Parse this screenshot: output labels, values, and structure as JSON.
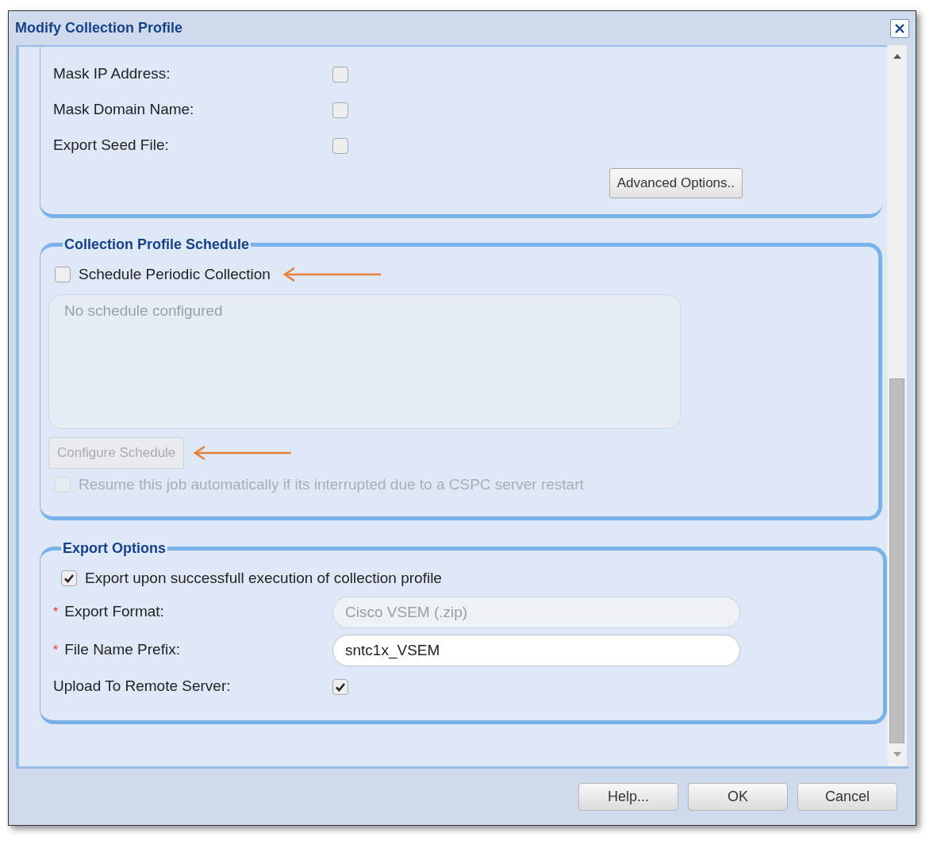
{
  "window": {
    "title": "Modify Collection Profile"
  },
  "options": {
    "rows": [
      {
        "label": "Mask IP Address:",
        "checked": false
      },
      {
        "label": "Mask Domain Name:",
        "checked": false
      },
      {
        "label": "Export Seed File:",
        "checked": false
      }
    ],
    "button": {
      "label": "Advanced Options.."
    }
  },
  "schedule": {
    "legend": "Collection Profile Schedule",
    "periodic": {
      "label": "Schedule Periodic Collection",
      "checked": false
    },
    "schedule_box": {
      "placeholder": "No schedule configured",
      "disabled": true
    },
    "configure_button": {
      "label": "Configure Schedule",
      "disabled": true
    },
    "resume": {
      "label": "Resume this job automatically if its interrupted due to a CSPC server restart",
      "checked": false,
      "disabled": true
    }
  },
  "export": {
    "legend": "Export Options",
    "export_on_success": {
      "label": "Export upon successfull execution of collection profile",
      "checked": true
    },
    "fields": [
      {
        "label": "Export Format:",
        "required_mark": "*",
        "value": "Cisco VSEM (.zip)",
        "disabled": true
      },
      {
        "label": "File Name Prefix:",
        "required_mark": "*",
        "value": "sntc1x_VSEM",
        "disabled": false
      }
    ],
    "upload": {
      "label": "Upload To Remote Server:",
      "checked": true
    }
  },
  "buttons": [
    {
      "label": "Help..."
    },
    {
      "label": "OK"
    },
    {
      "label": "Cancel"
    }
  ]
}
